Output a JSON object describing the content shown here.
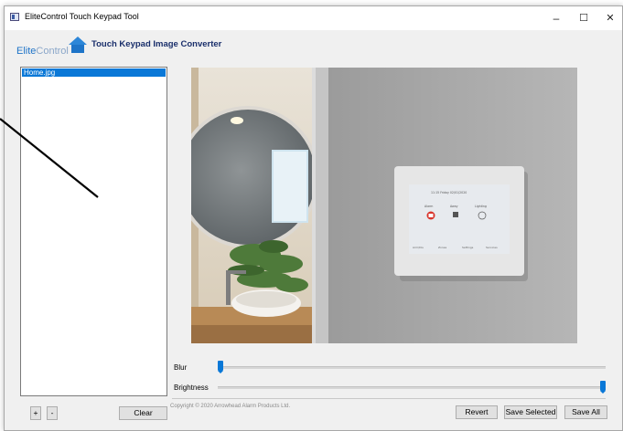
{
  "window": {
    "title": "EliteControl Touch Keypad Tool",
    "controls": {
      "minimize": "–",
      "maximize": "☐",
      "close": "✕"
    }
  },
  "header": {
    "logo_elite": "Elite",
    "logo_control": "Control",
    "heading": "Touch Keypad Image Converter"
  },
  "file_list": {
    "items": [
      {
        "label": "Home.jpg",
        "selected": true
      }
    ]
  },
  "preview": {
    "keypad_screen": {
      "status_text": "11:15   Friday   02/01/2020",
      "tiles": [
        "Alarm",
        "Away",
        "Lighting"
      ],
      "nav": [
        "Arm/Dis",
        "Zones",
        "Settings",
        "Services"
      ]
    }
  },
  "controls": {
    "blur_label": "Blur",
    "blur_value": 0.0,
    "brightness_label": "Brightness",
    "brightness_value": 1.0
  },
  "footer": {
    "add_label": "+",
    "remove_label": "-",
    "clear_label": "Clear",
    "copyright": "Copyright © 2020 Arrowhead Alarm Products Ltd.",
    "revert_label": "Revert",
    "save_selected_label": "Save Selected",
    "save_all_label": "Save All"
  },
  "colors": {
    "accent": "#0a78d7",
    "heading": "#1a2f6b",
    "logo_blue": "#1e74c8"
  }
}
